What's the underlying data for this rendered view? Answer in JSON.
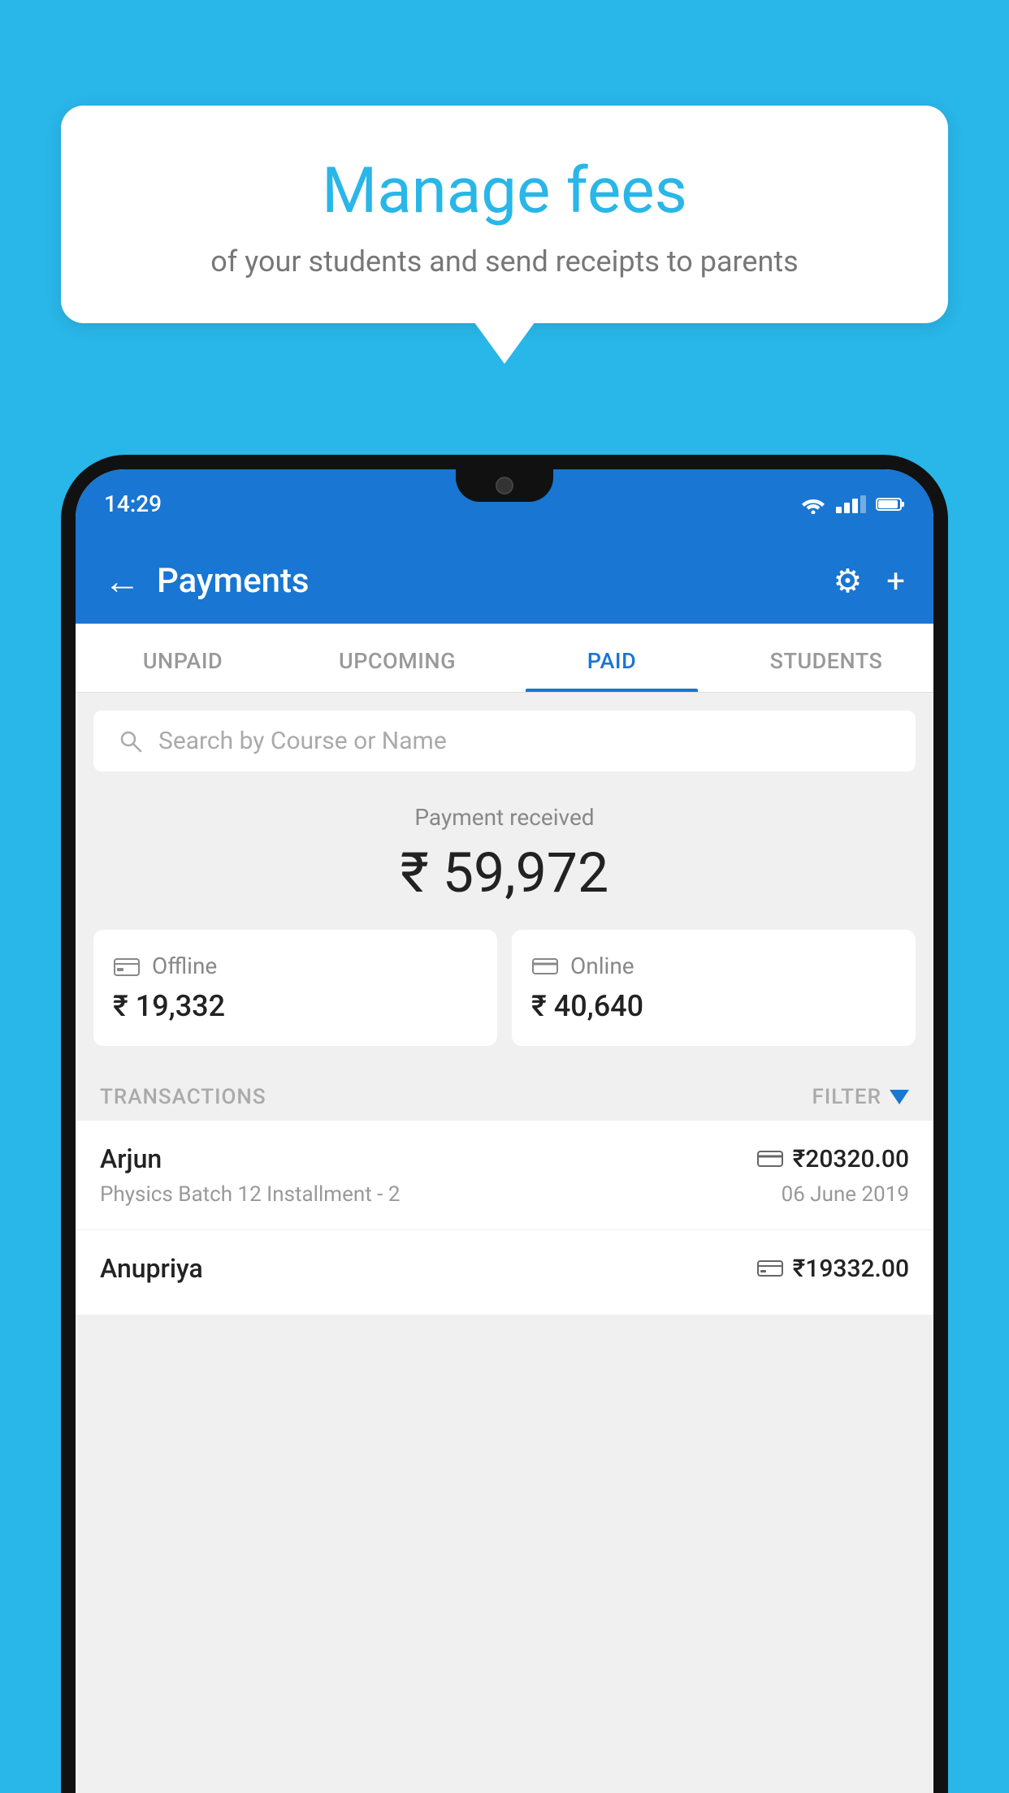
{
  "background_color": "#29b6e8",
  "speech_bubble": {
    "title": "Manage fees",
    "subtitle": "of your students and send receipts to parents"
  },
  "phone": {
    "status_bar": {
      "time": "14:29"
    },
    "header": {
      "title": "Payments",
      "back_label": "←",
      "settings_label": "⚙",
      "add_label": "+"
    },
    "tabs": [
      {
        "label": "UNPAID",
        "active": false
      },
      {
        "label": "UPCOMING",
        "active": false
      },
      {
        "label": "PAID",
        "active": true
      },
      {
        "label": "STUDENTS",
        "active": false
      }
    ],
    "search": {
      "placeholder": "Search by Course or Name"
    },
    "payment_received": {
      "label": "Payment received",
      "amount": "₹ 59,972"
    },
    "payment_cards": [
      {
        "type": "Offline",
        "icon": "₹",
        "amount": "₹ 19,332"
      },
      {
        "type": "Online",
        "icon": "💳",
        "amount": "₹ 40,640"
      }
    ],
    "transactions_header": {
      "label": "TRANSACTIONS",
      "filter_label": "FILTER"
    },
    "transactions": [
      {
        "name": "Arjun",
        "detail": "Physics Batch 12 Installment - 2",
        "amount": "₹20320.00",
        "date": "06 June 2019",
        "payment_type": "online"
      },
      {
        "name": "Anupriya",
        "detail": "",
        "amount": "₹19332.00",
        "date": "",
        "payment_type": "offline"
      }
    ]
  }
}
